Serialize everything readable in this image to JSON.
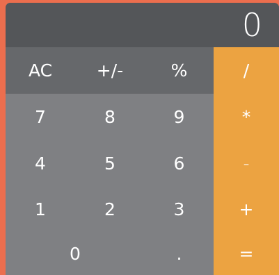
{
  "display": {
    "value": "0"
  },
  "keys": {
    "ac": "AC",
    "sign": "+/-",
    "percent": "%",
    "divide": "/",
    "seven": "7",
    "eight": "8",
    "nine": "9",
    "multiply": "*",
    "four": "4",
    "five": "5",
    "six": "6",
    "subtract": "-",
    "one": "1",
    "two": "2",
    "three": "3",
    "add": "+",
    "zero": "0",
    "decimal": ".",
    "equals": "="
  },
  "colors": {
    "background": "#ec6e4e",
    "display": "#545659",
    "function_keys": "#66686b",
    "number_keys": "#7f8083",
    "operator_keys": "#eca341"
  }
}
